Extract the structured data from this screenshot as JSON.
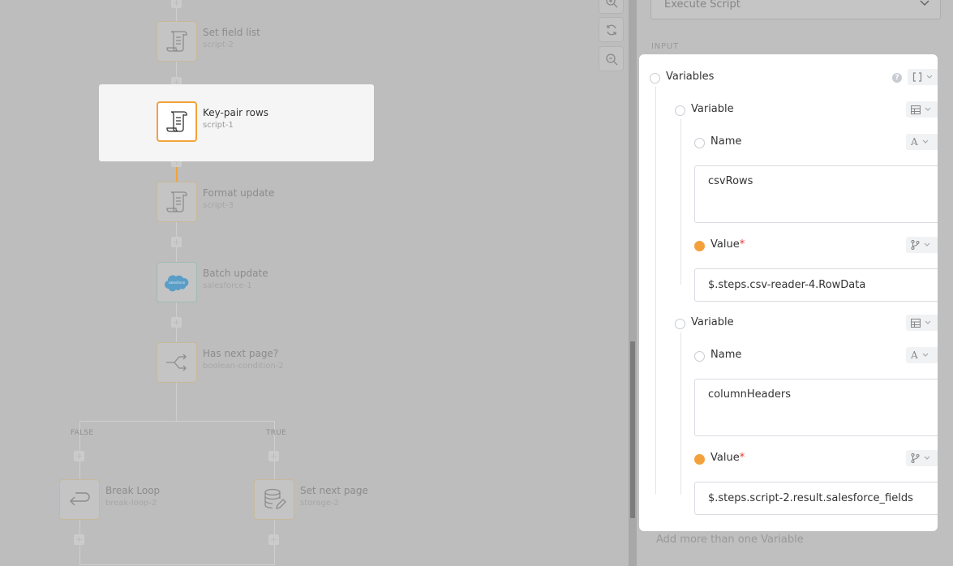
{
  "canvas": {
    "nodes": [
      {
        "title": "Set field list",
        "sub": "script-2",
        "icon": "script-icon"
      },
      {
        "title": "Key-pair rows",
        "sub": "script-1",
        "icon": "script-icon"
      },
      {
        "title": "Format update",
        "sub": "script-3",
        "icon": "script-icon"
      },
      {
        "title": "Batch update",
        "sub": "salesforce-1",
        "icon": "salesforce-icon"
      },
      {
        "title": "Has next page?",
        "sub": "boolean-condition-2",
        "icon": "branch-icon"
      },
      {
        "title": "Break Loop",
        "sub": "break-loop-2",
        "icon": "return-arrow-icon"
      },
      {
        "title": "Set next page",
        "sub": "storage-2",
        "icon": "database-edit-icon"
      }
    ],
    "branch_false": "FALSE",
    "branch_true": "TRUE",
    "salesforce_text": "salesforce",
    "zoom_controls": [
      "zoom-in-icon",
      "refresh-icon",
      "zoom-out-icon"
    ]
  },
  "panel": {
    "action_select": "Execute Script",
    "section_label": "INPUT",
    "variables_label": "Variables",
    "variable_label": "Variable",
    "name_label": "Name",
    "value_label": "Value",
    "required_mark": "*",
    "variables": [
      {
        "name": "csvRows",
        "value": "$.steps.csv-reader-4.RowData"
      },
      {
        "name": "columnHeaders",
        "value": "$.steps.script-2.result.salesforce_fields"
      }
    ],
    "add_more": "Add more than one Variable"
  },
  "colors": {
    "accent": "#f2a33a",
    "required": "#e53935",
    "overlay": "#bdbdbd"
  }
}
